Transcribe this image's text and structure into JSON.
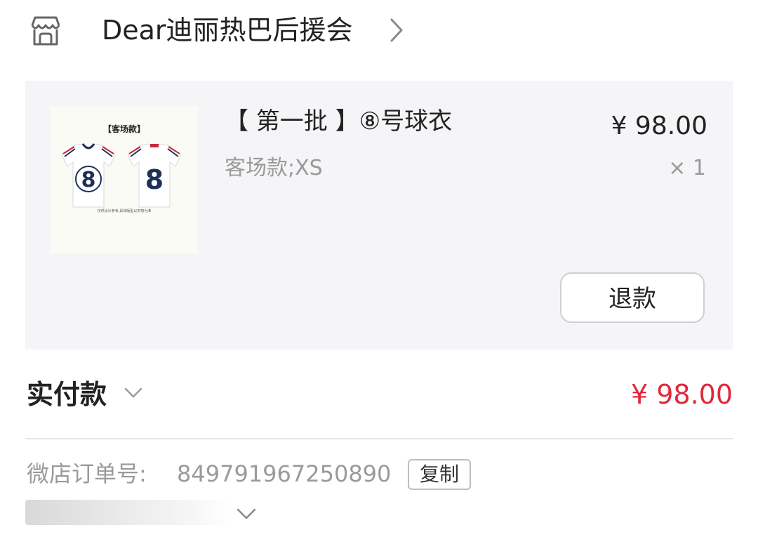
{
  "shop": {
    "icon": "shop-icon",
    "name": "Dear迪丽热巴后援会",
    "chevron_icon": "chevron-right-icon"
  },
  "product": {
    "thumbnail": {
      "tag": "【客场款】",
      "jersey_number": "8",
      "note": "仅供设计参考,具体版型以实物为准"
    },
    "title": "【 第一批 】⑧号球衣",
    "spec": "客场款;XS",
    "price": "¥ 98.00",
    "quantity": "× 1",
    "refund_label": "退款"
  },
  "summary": {
    "paid_label": "实付款",
    "paid_chevron_icon": "chevron-down-icon",
    "paid_amount": "¥ 98.00"
  },
  "order": {
    "label": "微店订单号:",
    "number": "849791967250890",
    "copy_label": "复制",
    "expand_icon": "chevron-down-icon"
  },
  "colors": {
    "price_red": "#e0283c",
    "card_bg": "#f5f5f7",
    "muted_text": "#9a9a9a",
    "jersey_navy": "#1f2f5a",
    "jersey_red": "#c8283a"
  }
}
